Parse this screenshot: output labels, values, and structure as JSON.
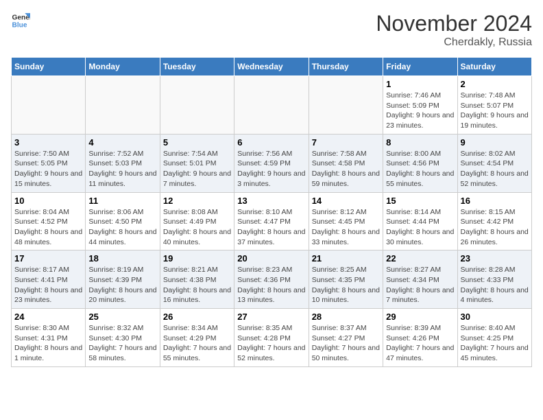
{
  "header": {
    "logo_line1": "General",
    "logo_line2": "Blue",
    "month": "November 2024",
    "location": "Cherdakly, Russia"
  },
  "weekdays": [
    "Sunday",
    "Monday",
    "Tuesday",
    "Wednesday",
    "Thursday",
    "Friday",
    "Saturday"
  ],
  "weeks": [
    [
      {
        "day": "",
        "info": ""
      },
      {
        "day": "",
        "info": ""
      },
      {
        "day": "",
        "info": ""
      },
      {
        "day": "",
        "info": ""
      },
      {
        "day": "",
        "info": ""
      },
      {
        "day": "1",
        "info": "Sunrise: 7:46 AM\nSunset: 5:09 PM\nDaylight: 9 hours and 23 minutes."
      },
      {
        "day": "2",
        "info": "Sunrise: 7:48 AM\nSunset: 5:07 PM\nDaylight: 9 hours and 19 minutes."
      }
    ],
    [
      {
        "day": "3",
        "info": "Sunrise: 7:50 AM\nSunset: 5:05 PM\nDaylight: 9 hours and 15 minutes."
      },
      {
        "day": "4",
        "info": "Sunrise: 7:52 AM\nSunset: 5:03 PM\nDaylight: 9 hours and 11 minutes."
      },
      {
        "day": "5",
        "info": "Sunrise: 7:54 AM\nSunset: 5:01 PM\nDaylight: 9 hours and 7 minutes."
      },
      {
        "day": "6",
        "info": "Sunrise: 7:56 AM\nSunset: 4:59 PM\nDaylight: 9 hours and 3 minutes."
      },
      {
        "day": "7",
        "info": "Sunrise: 7:58 AM\nSunset: 4:58 PM\nDaylight: 8 hours and 59 minutes."
      },
      {
        "day": "8",
        "info": "Sunrise: 8:00 AM\nSunset: 4:56 PM\nDaylight: 8 hours and 55 minutes."
      },
      {
        "day": "9",
        "info": "Sunrise: 8:02 AM\nSunset: 4:54 PM\nDaylight: 8 hours and 52 minutes."
      }
    ],
    [
      {
        "day": "10",
        "info": "Sunrise: 8:04 AM\nSunset: 4:52 PM\nDaylight: 8 hours and 48 minutes."
      },
      {
        "day": "11",
        "info": "Sunrise: 8:06 AM\nSunset: 4:50 PM\nDaylight: 8 hours and 44 minutes."
      },
      {
        "day": "12",
        "info": "Sunrise: 8:08 AM\nSunset: 4:49 PM\nDaylight: 8 hours and 40 minutes."
      },
      {
        "day": "13",
        "info": "Sunrise: 8:10 AM\nSunset: 4:47 PM\nDaylight: 8 hours and 37 minutes."
      },
      {
        "day": "14",
        "info": "Sunrise: 8:12 AM\nSunset: 4:45 PM\nDaylight: 8 hours and 33 minutes."
      },
      {
        "day": "15",
        "info": "Sunrise: 8:14 AM\nSunset: 4:44 PM\nDaylight: 8 hours and 30 minutes."
      },
      {
        "day": "16",
        "info": "Sunrise: 8:15 AM\nSunset: 4:42 PM\nDaylight: 8 hours and 26 minutes."
      }
    ],
    [
      {
        "day": "17",
        "info": "Sunrise: 8:17 AM\nSunset: 4:41 PM\nDaylight: 8 hours and 23 minutes."
      },
      {
        "day": "18",
        "info": "Sunrise: 8:19 AM\nSunset: 4:39 PM\nDaylight: 8 hours and 20 minutes."
      },
      {
        "day": "19",
        "info": "Sunrise: 8:21 AM\nSunset: 4:38 PM\nDaylight: 8 hours and 16 minutes."
      },
      {
        "day": "20",
        "info": "Sunrise: 8:23 AM\nSunset: 4:36 PM\nDaylight: 8 hours and 13 minutes."
      },
      {
        "day": "21",
        "info": "Sunrise: 8:25 AM\nSunset: 4:35 PM\nDaylight: 8 hours and 10 minutes."
      },
      {
        "day": "22",
        "info": "Sunrise: 8:27 AM\nSunset: 4:34 PM\nDaylight: 8 hours and 7 minutes."
      },
      {
        "day": "23",
        "info": "Sunrise: 8:28 AM\nSunset: 4:33 PM\nDaylight: 8 hours and 4 minutes."
      }
    ],
    [
      {
        "day": "24",
        "info": "Sunrise: 8:30 AM\nSunset: 4:31 PM\nDaylight: 8 hours and 1 minute."
      },
      {
        "day": "25",
        "info": "Sunrise: 8:32 AM\nSunset: 4:30 PM\nDaylight: 7 hours and 58 minutes."
      },
      {
        "day": "26",
        "info": "Sunrise: 8:34 AM\nSunset: 4:29 PM\nDaylight: 7 hours and 55 minutes."
      },
      {
        "day": "27",
        "info": "Sunrise: 8:35 AM\nSunset: 4:28 PM\nDaylight: 7 hours and 52 minutes."
      },
      {
        "day": "28",
        "info": "Sunrise: 8:37 AM\nSunset: 4:27 PM\nDaylight: 7 hours and 50 minutes."
      },
      {
        "day": "29",
        "info": "Sunrise: 8:39 AM\nSunset: 4:26 PM\nDaylight: 7 hours and 47 minutes."
      },
      {
        "day": "30",
        "info": "Sunrise: 8:40 AM\nSunset: 4:25 PM\nDaylight: 7 hours and 45 minutes."
      }
    ]
  ]
}
